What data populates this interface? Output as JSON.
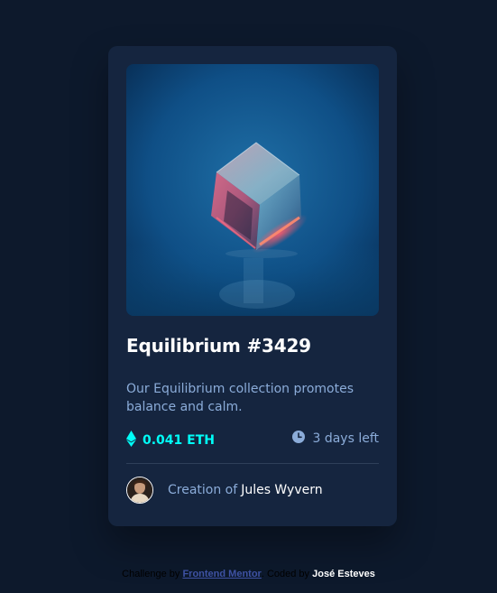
{
  "card": {
    "image_alt": "Equilibrium",
    "title": "Equilibrium #3429",
    "description": "Our Equilibrium collection promotes balance and calm.",
    "price": "0.041 ETH",
    "time_left": "3 days left",
    "creator_prefix": "Creation of",
    "creator_name": "Jules Wyvern",
    "icons": {
      "price": "ethereum-icon",
      "time": "clock-icon"
    }
  },
  "attribution": {
    "prefix": "Challenge by",
    "link": "Frontend Mentor",
    "middle": ". Coded by",
    "author": "José Esteves"
  },
  "colors": {
    "page_bg": "#0d192c",
    "card_bg": "#15253f",
    "accent_cyan": "#00fff8",
    "soft_blue": "#8bacd9",
    "white": "#ffffff",
    "divider": "#2e405a"
  }
}
